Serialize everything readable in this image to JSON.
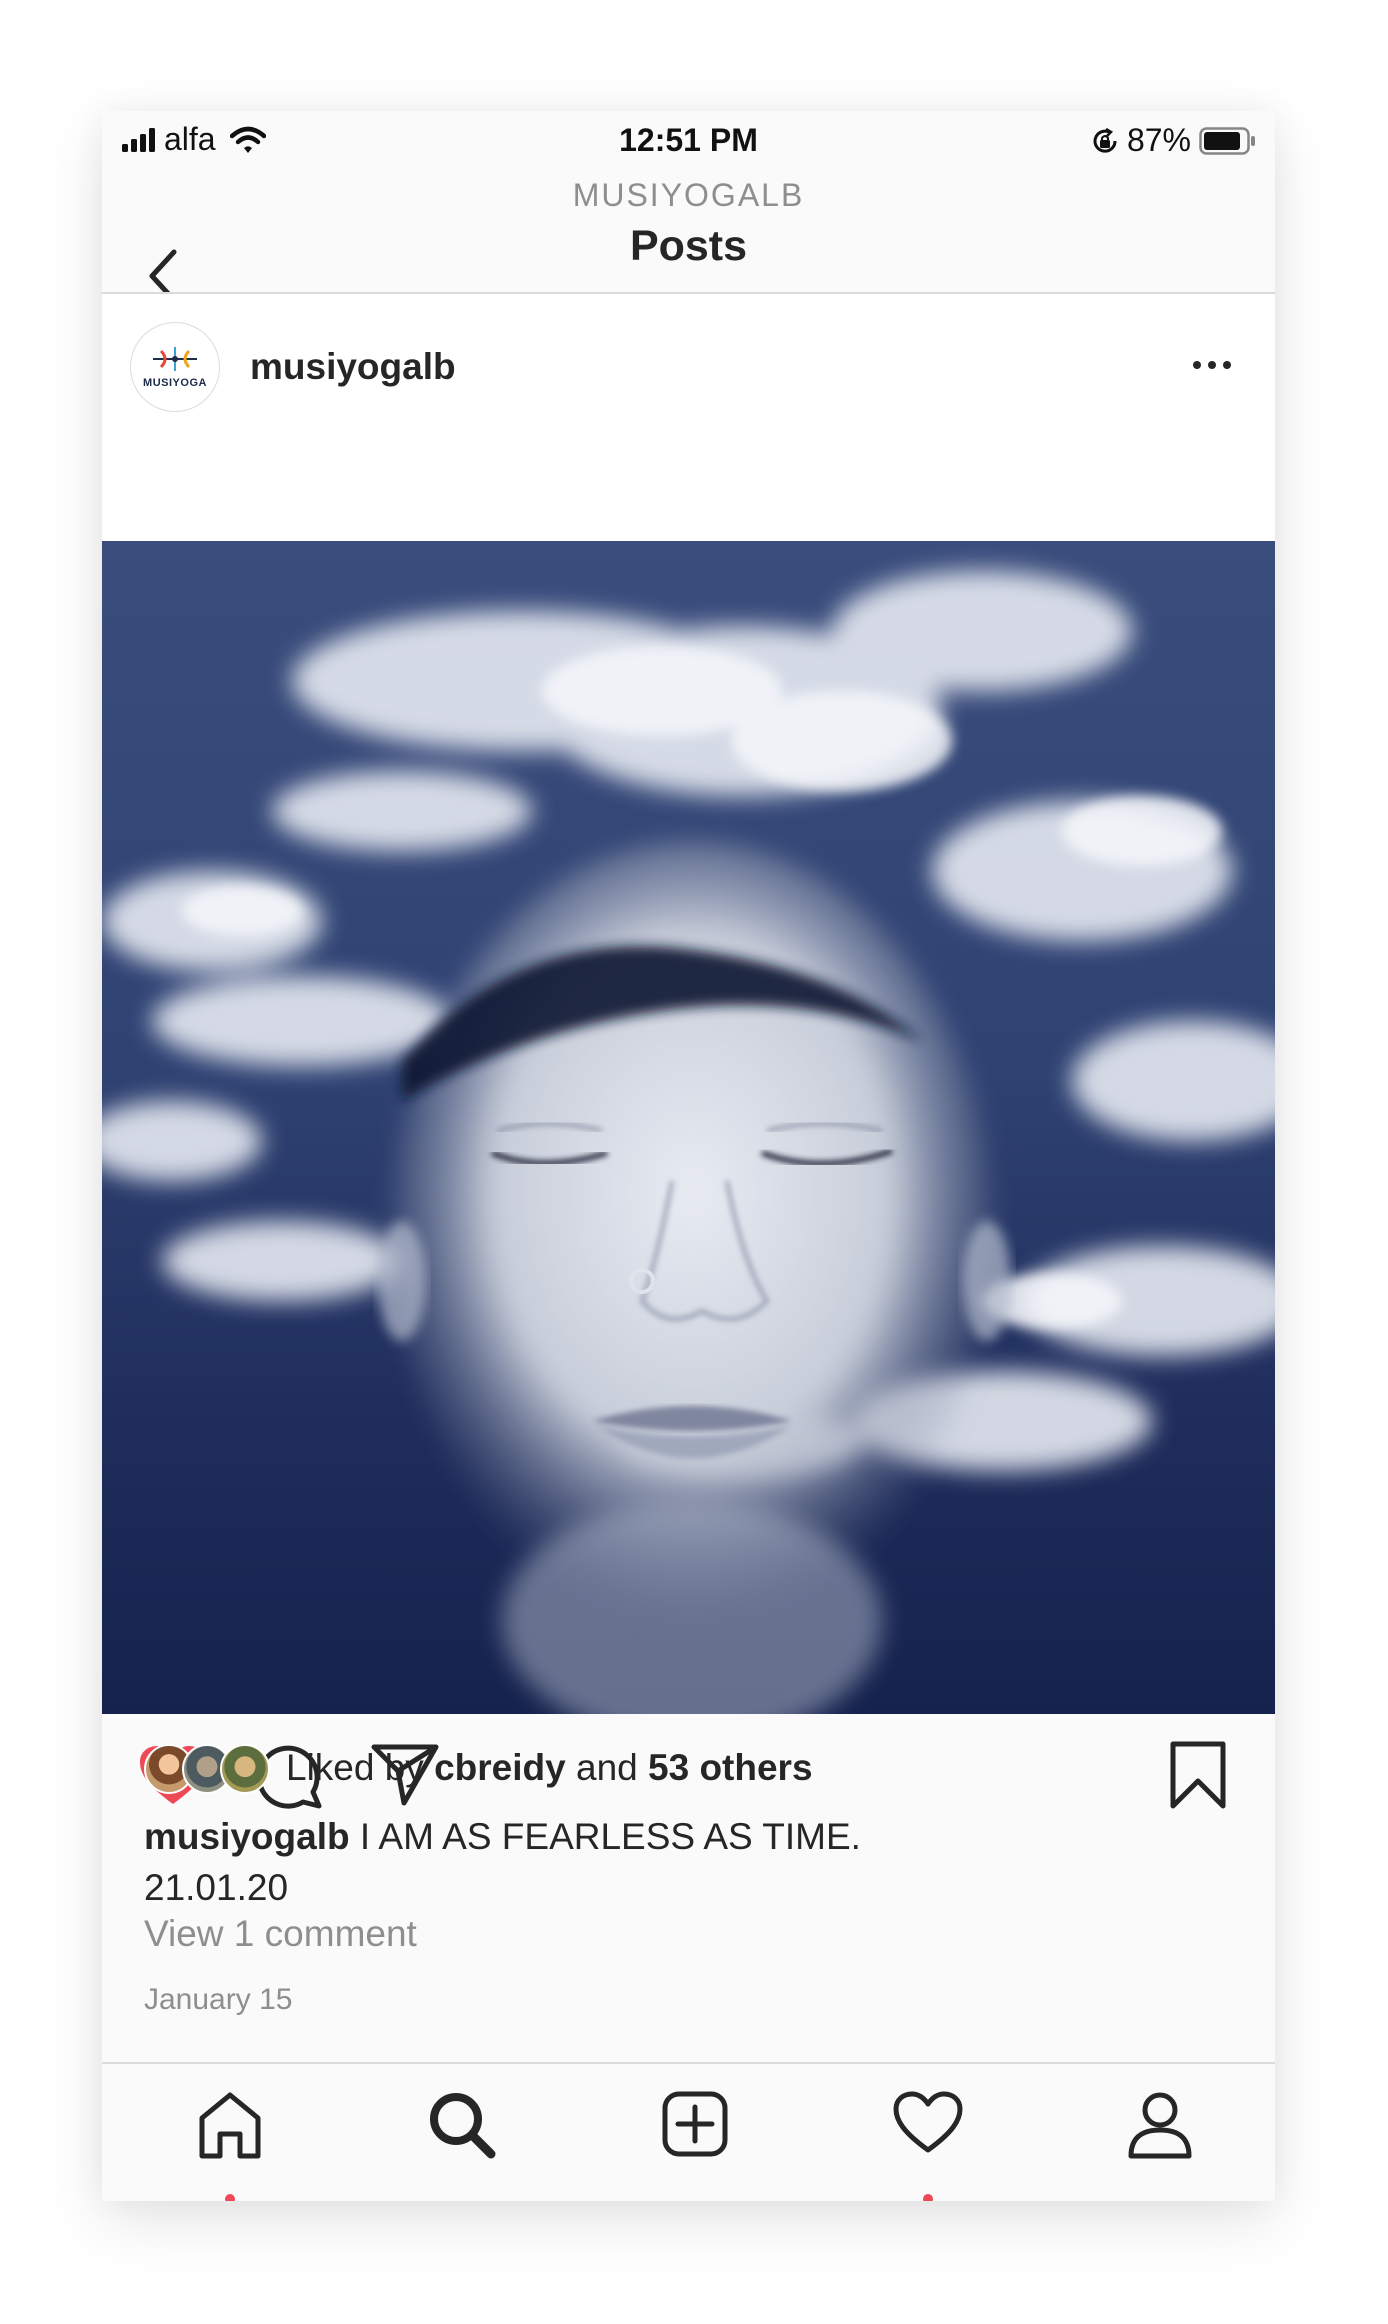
{
  "status_bar": {
    "carrier": "alfa",
    "time": "12:51 PM",
    "battery_percent": "87%",
    "battery_level": 0.87,
    "icons": [
      "signal-bars-icon",
      "wifi-icon",
      "orientation-lock-icon",
      "battery-icon"
    ]
  },
  "nav": {
    "username": "MUSIYOGALB",
    "title": "Posts",
    "back_icon": "chevron-left-icon"
  },
  "post": {
    "username": "musiyogalb",
    "avatar_brand": "MUSIYOGA",
    "more_icon": "ellipsis-icon",
    "image_description_colors": {
      "sky": "#1d2b53",
      "cloud": "#dfe4ee"
    },
    "liked": true,
    "likes": {
      "prefix": "Liked by",
      "user": "cbreidy",
      "middle": "and",
      "others": "53 others"
    },
    "caption_user": "musiyogalb",
    "caption_text": "I AM AS FEARLESS AS TIME.",
    "caption_line2": "21.01.20",
    "view_comments": "View 1 comment",
    "date": "January 15"
  },
  "actions": {
    "like_icon": "heart-filled-icon",
    "comment_icon": "comment-icon",
    "share_icon": "paper-plane-icon",
    "save_icon": "bookmark-icon"
  },
  "tabbar": {
    "tabs": [
      {
        "icon": "home-icon",
        "notification_dot": true
      },
      {
        "icon": "search-icon",
        "notification_dot": false
      },
      {
        "icon": "add-post-icon",
        "notification_dot": false
      },
      {
        "icon": "heart-icon",
        "notification_dot": true
      },
      {
        "icon": "profile-icon",
        "notification_dot": false
      }
    ]
  },
  "colors": {
    "like_red": "#ed4956",
    "text": "#262626",
    "secondary": "#8e8e8e",
    "divider": "#dbdbdb"
  }
}
